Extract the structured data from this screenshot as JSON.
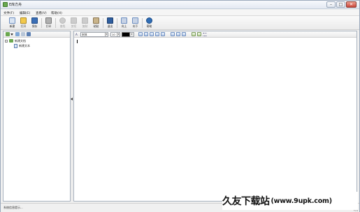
{
  "window": {
    "title": "E库方舟",
    "buttons": {
      "minimize": "–",
      "maximize": "□",
      "close": "✕"
    }
  },
  "menu": [
    {
      "label": "文件(F)"
    },
    {
      "label": "编辑(E)"
    },
    {
      "label": "查看(V)"
    },
    {
      "label": "帮助(H)"
    }
  ],
  "toolbar": {
    "buttons": [
      {
        "label": "新建",
        "icon": "new-doc-icon",
        "color": "#d9e4f2",
        "enabled": true
      },
      {
        "label": "打开",
        "icon": "open-folder-icon",
        "color": "#f2c94c",
        "enabled": true
      },
      {
        "label": "保存",
        "icon": "save-disk-icon",
        "color": "#3b6fb6",
        "enabled": true
      },
      {
        "label": "打印",
        "icon": "print-icon",
        "color": "#b0b0b0",
        "enabled": true
      },
      {
        "label": "查找",
        "icon": "find-icon",
        "color": "#9c9c9c",
        "enabled": false
      },
      {
        "label": "剪切",
        "icon": "cut-icon",
        "color": "#9c9c9c",
        "enabled": false
      },
      {
        "label": "复制",
        "icon": "copy-icon",
        "color": "#9c9c9c",
        "enabled": false
      },
      {
        "label": "粘贴",
        "icon": "paste-icon",
        "color": "#c9b48a",
        "enabled": true
      },
      {
        "label": "退出",
        "icon": "exit-icon",
        "color": "#2f5e9e",
        "enabled": true
      },
      {
        "label": "向上",
        "icon": "up-icon",
        "color": "#c7d3e6",
        "enabled": true
      },
      {
        "label": "向下",
        "icon": "down-icon",
        "color": "#c7d3e6",
        "enabled": true
      },
      {
        "label": "帮助",
        "icon": "help-icon",
        "color": "#2f6db5",
        "enabled": true
      }
    ]
  },
  "tree": {
    "root": {
      "label": "新建文档",
      "expander": "-"
    },
    "children": [
      {
        "label": "新建文本"
      }
    ]
  },
  "format": {
    "font_value": "宋体",
    "size_value": "10",
    "text_color": "#000000"
  },
  "status": {
    "text": "系统信息提示..."
  },
  "watermark": {
    "cn": "久友下载站",
    "url": "(www.9upk.com)"
  }
}
